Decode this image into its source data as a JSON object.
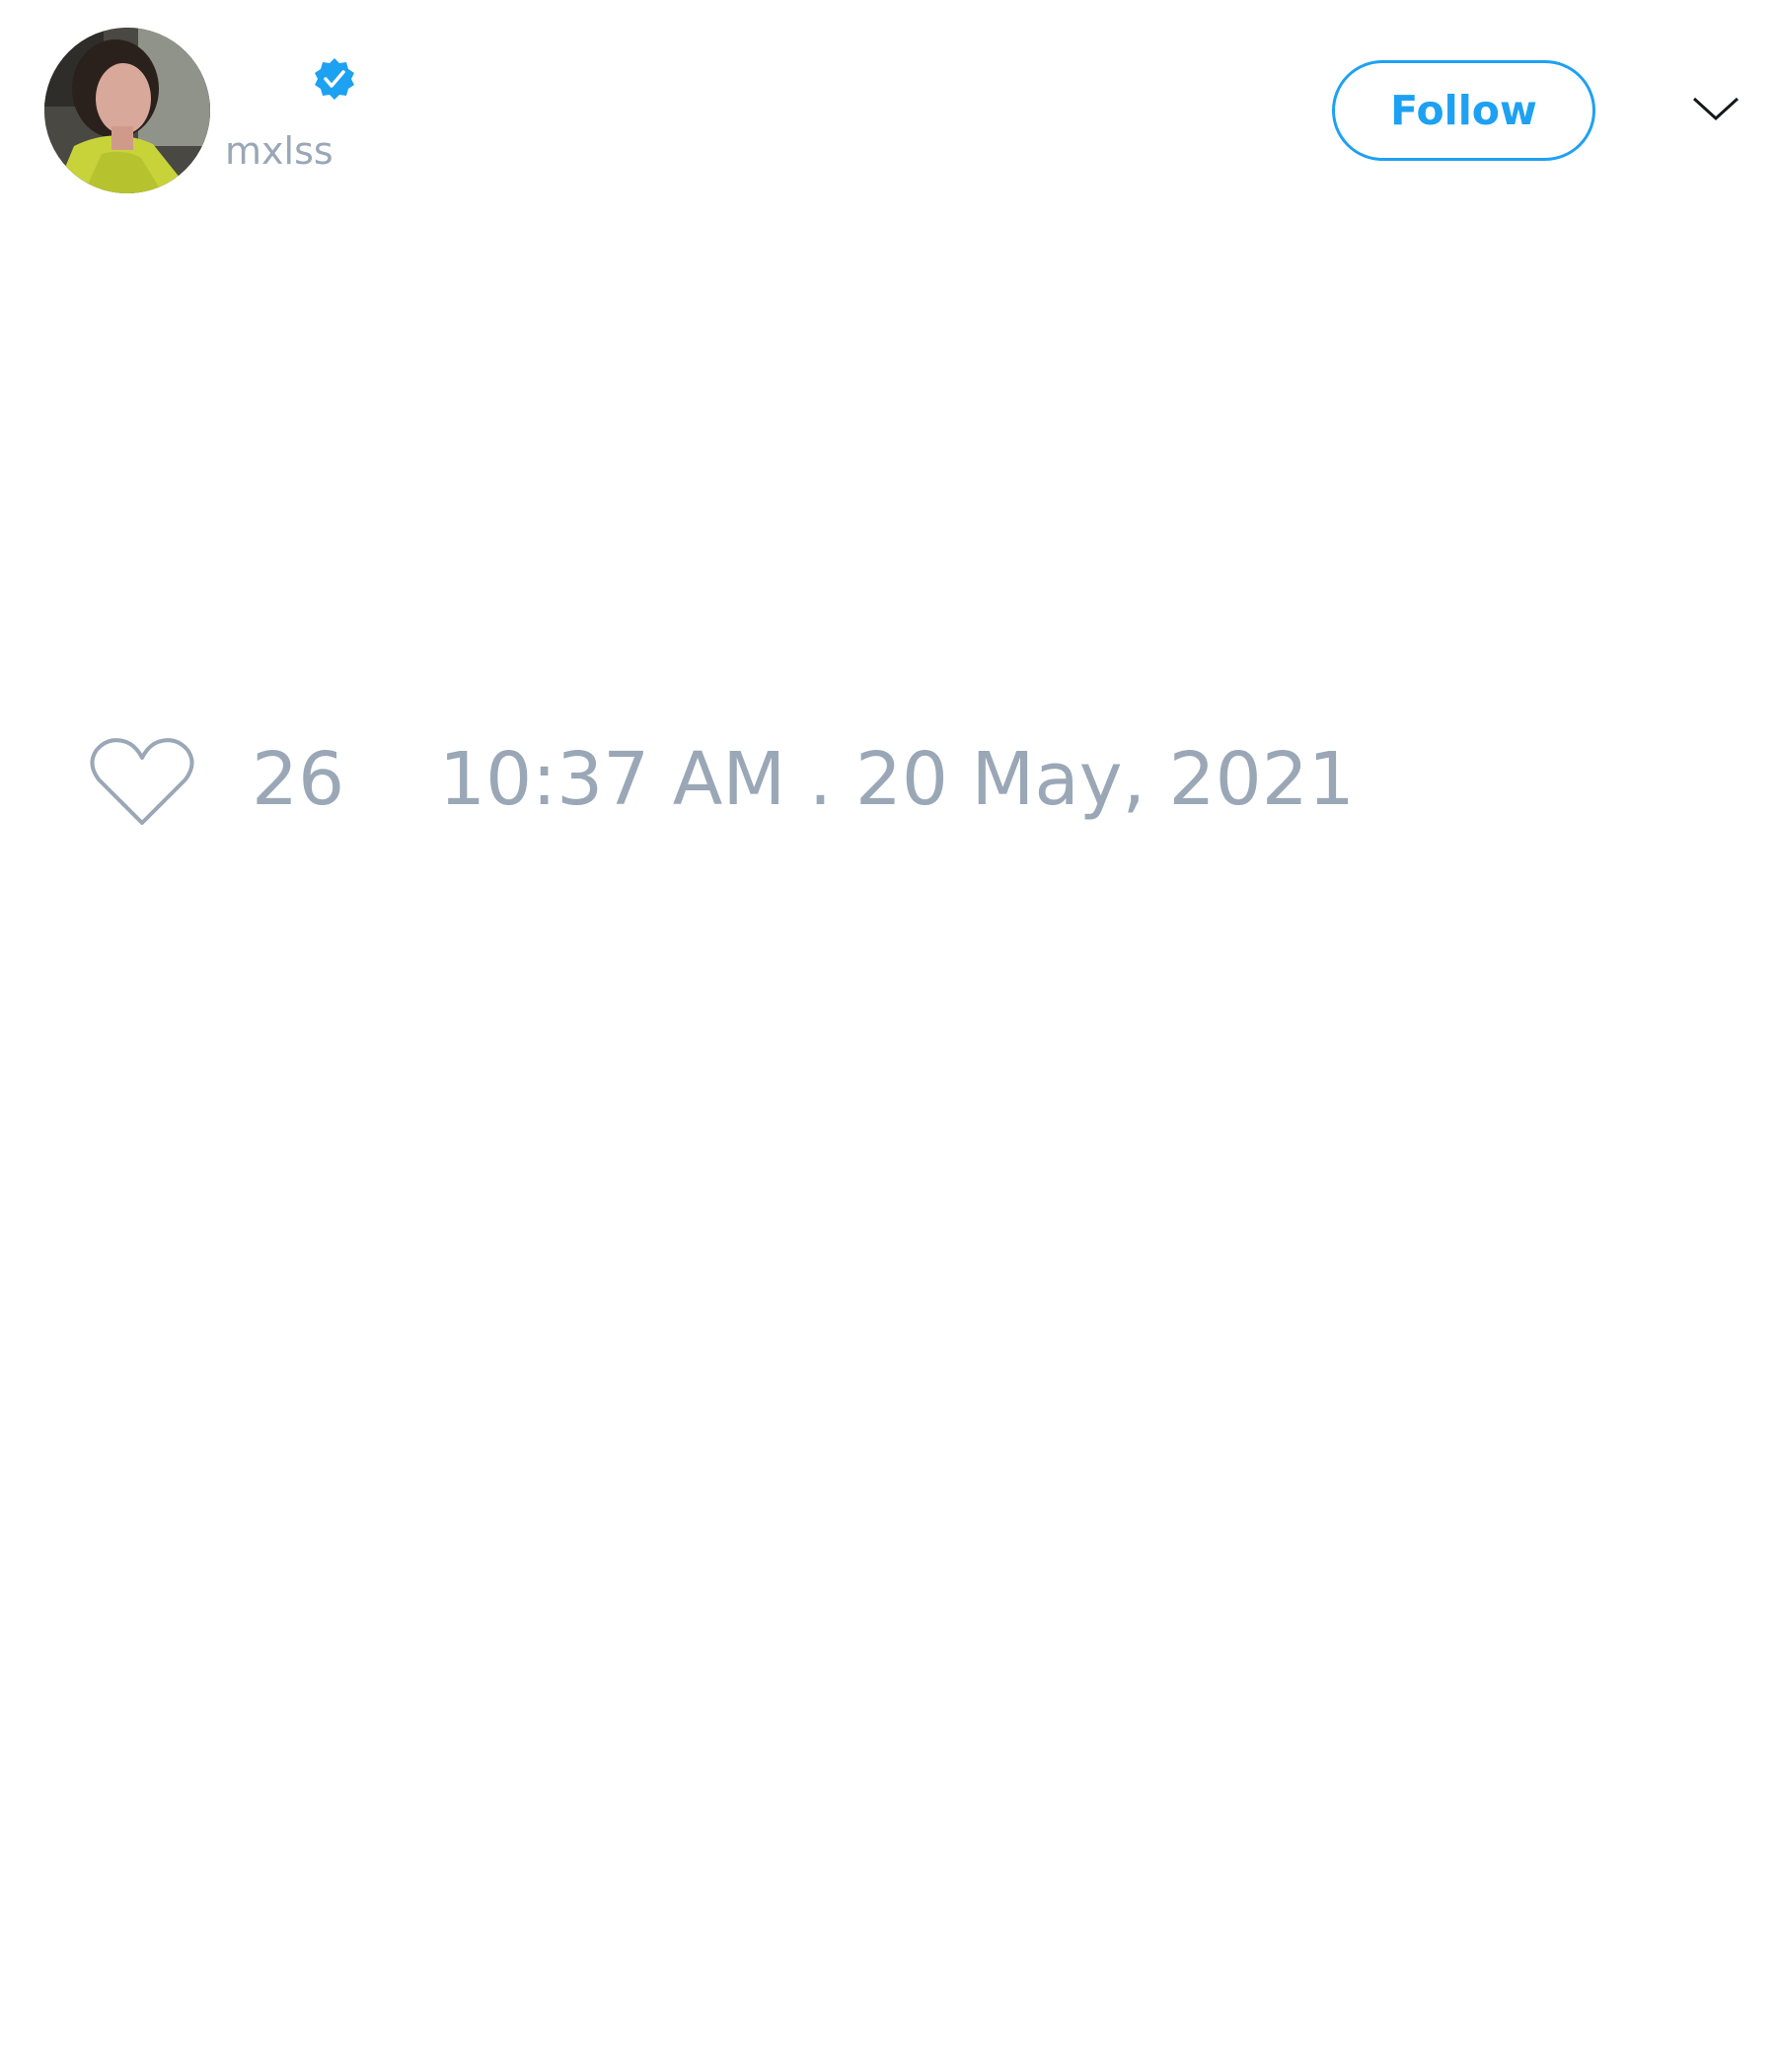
{
  "tweet": {
    "author": {
      "display_name": "",
      "handle": "mxlss",
      "verified": true,
      "avatar_icon": "profile-photo"
    },
    "follow_label": "Follow",
    "menu_icon": "chevron-down-icon",
    "like_icon": "heart-outline-icon",
    "like_count": "26",
    "timestamp": "10:37 AM . 20 May, 2021"
  },
  "colors": {
    "accent": "#1da1f2",
    "muted_text": "#9aa7b6",
    "background": "#ffffff"
  }
}
